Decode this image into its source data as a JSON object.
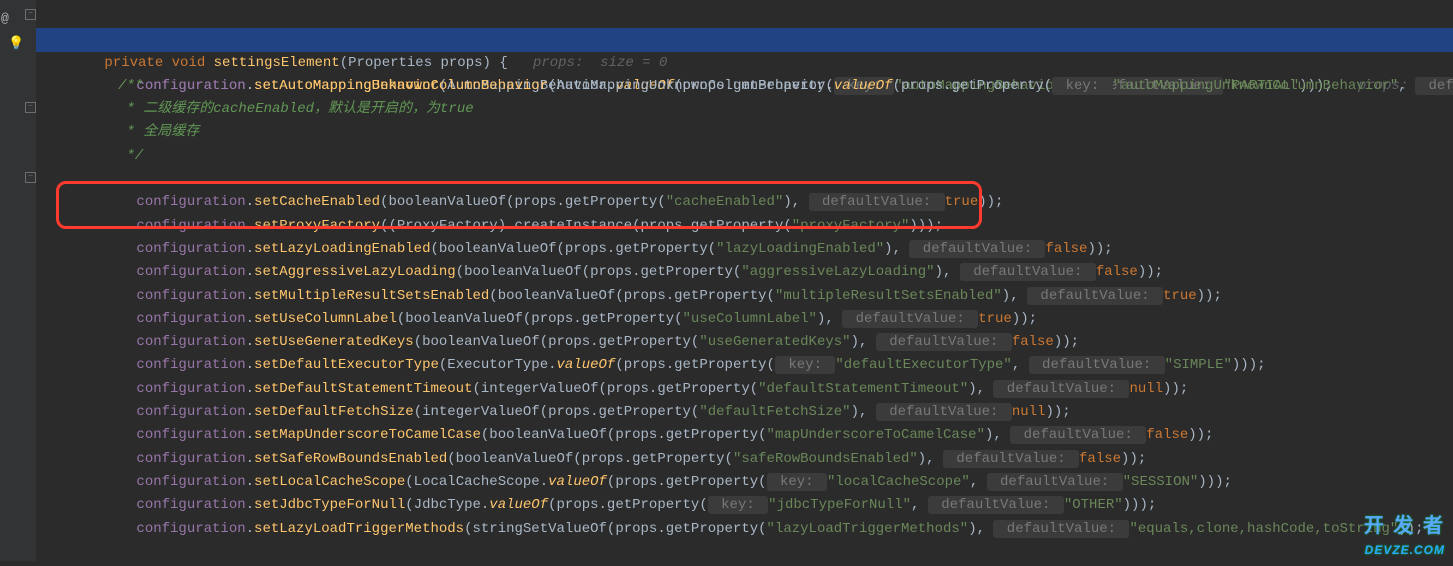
{
  "gutter": {
    "at": "@"
  },
  "signature": {
    "keyword1": "private",
    "keyword2": "void",
    "method": "settingsElement",
    "params": "(Properties props) {",
    "inline_hint": "props:  size = 0"
  },
  "l1": {
    "obj": "configuration",
    "dot": ".",
    "method": "setAutoMappingBehavior",
    "open": "(AutoMappingBehavior.",
    "static": "valueOf",
    "mid": "(props.getProperty(",
    "h_key": " key: ",
    "str": "\"autoMappingBehavior\"",
    "comma": ",",
    "h_def": " defaultValue: ",
    "val": "\"PARTIAL\"",
    "close": ")));",
    "inline_hint": "props:  size = 0"
  },
  "l2": {
    "obj": "configuration",
    "method": "setAutoMappingUnknownColumnBehavior",
    "open": "(AutoMappingUnknownColumnBehavior.",
    "static": "valueOf",
    "mid": "(props.getProperty(",
    "h_key": " key: ",
    "str": "\"autoMappingUnknownColumnBehavior\"",
    "comma": ",",
    "h_def": " defa"
  },
  "doc": {
    "open": "/**",
    "l1": " * 二级缓存的cacheEnabled，默认是开启的，为true",
    "l2": " * 全局缓存",
    "close": " */"
  },
  "l3": {
    "obj": "configuration",
    "method": "setCacheEnabled",
    "open": "(booleanValueOf(props.getProperty(",
    "str": "\"cacheEnabled\"",
    "comma": "),",
    "h_def": " defaultValue: ",
    "val": "true",
    "close": "));"
  },
  "l4": {
    "obj": "configuration",
    "method": "setProxyFactory",
    "open": "((ProxyFactory) createInstance(props.getProperty(",
    "str": "\"proxyFactory\"",
    "close": ")));"
  },
  "l5": {
    "obj": "configuration",
    "method": "setLazyLoadingEnabled",
    "open": "(booleanValueOf(props.getProperty(",
    "str": "\"lazyLoadingEnabled\"",
    "comma": "),",
    "h_def": " defaultValue: ",
    "val": "false",
    "close": "));"
  },
  "l6": {
    "obj": "configuration",
    "method": "setAggressiveLazyLoading",
    "open": "(booleanValueOf(props.getProperty(",
    "str": "\"aggressiveLazyLoading\"",
    "comma": "),",
    "h_def": " defaultValue: ",
    "val": "false",
    "close": "));"
  },
  "l7": {
    "obj": "configuration",
    "method": "setMultipleResultSetsEnabled",
    "open": "(booleanValueOf(props.getProperty(",
    "str": "\"multipleResultSetsEnabled\"",
    "comma": "),",
    "h_def": " defaultValue: ",
    "val": "true",
    "close": "));"
  },
  "l8": {
    "obj": "configuration",
    "method": "setUseColumnLabel",
    "open": "(booleanValueOf(props.getProperty(",
    "str": "\"useColumnLabel\"",
    "comma": "),",
    "h_def": " defaultValue: ",
    "val": "true",
    "close": "));"
  },
  "l9": {
    "obj": "configuration",
    "method": "setUseGeneratedKeys",
    "open": "(booleanValueOf(props.getProperty(",
    "str": "\"useGeneratedKeys\"",
    "comma": "),",
    "h_def": " defaultValue: ",
    "val": "false",
    "close": "));"
  },
  "l10": {
    "obj": "configuration",
    "method": "setDefaultExecutorType",
    "open": "(ExecutorType.",
    "static": "valueOf",
    "mid": "(props.getProperty(",
    "h_key": " key: ",
    "str": "\"defaultExecutorType\"",
    "comma": ",",
    "h_def": " defaultValue: ",
    "val": "\"SIMPLE\"",
    "close": ")));"
  },
  "l11": {
    "obj": "configuration",
    "method": "setDefaultStatementTimeout",
    "open": "(integerValueOf(props.getProperty(",
    "str": "\"defaultStatementTimeout\"",
    "comma": "),",
    "h_def": " defaultValue: ",
    "val": "null",
    "close": "));"
  },
  "l12": {
    "obj": "configuration",
    "method": "setDefaultFetchSize",
    "open": "(integerValueOf(props.getProperty(",
    "str": "\"defaultFetchSize\"",
    "comma": "),",
    "h_def": " defaultValue: ",
    "val": "null",
    "close": "));"
  },
  "l13": {
    "obj": "configuration",
    "method": "setMapUnderscoreToCamelCase",
    "open": "(booleanValueOf(props.getProperty(",
    "str": "\"mapUnderscoreToCamelCase\"",
    "comma": "),",
    "h_def": " defaultValue: ",
    "val": "false",
    "close": "));"
  },
  "l14": {
    "obj": "configuration",
    "method": "setSafeRowBoundsEnabled",
    "open": "(booleanValueOf(props.getProperty(",
    "str": "\"safeRowBoundsEnabled\"",
    "comma": "),",
    "h_def": " defaultValue: ",
    "val": "false",
    "close": "));"
  },
  "l15": {
    "obj": "configuration",
    "method": "setLocalCacheScope",
    "open": "(LocalCacheScope.",
    "static": "valueOf",
    "mid": "(props.getProperty(",
    "h_key": " key: ",
    "str": "\"localCacheScope\"",
    "comma": ",",
    "h_def": " defaultValue: ",
    "val": "\"SESSION\"",
    "close": ")));"
  },
  "l16": {
    "obj": "configuration",
    "method": "setJdbcTypeForNull",
    "open": "(JdbcType.",
    "static": "valueOf",
    "mid": "(props.getProperty(",
    "h_key": " key: ",
    "str": "\"jdbcTypeForNull\"",
    "comma": ",",
    "h_def": " defaultValue: ",
    "val": "\"OTHER\"",
    "close": ")));"
  },
  "l17": {
    "obj": "configuration",
    "method": "setLazyLoadTriggerMethods",
    "open": "(stringSetValueOf(props.getProperty(",
    "str": "\"lazyLoadTriggerMethods\"",
    "comma": "),",
    "h_def": " defaultValue: ",
    "val": "\"equals,clone,hashCode,toString\"",
    "close": "));"
  },
  "watermark": {
    "cn": "开 发 者",
    "en": "DEVZE.COM"
  }
}
